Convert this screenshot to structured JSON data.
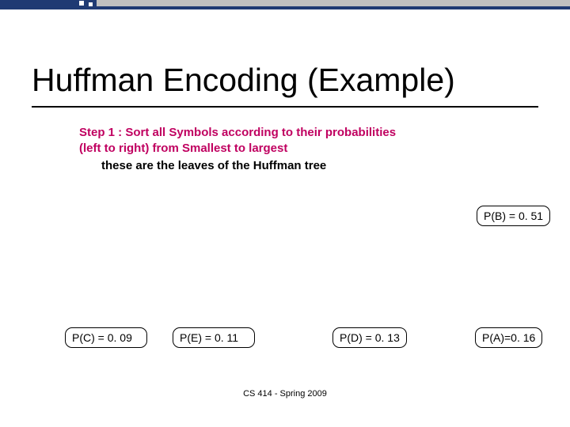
{
  "title": "Huffman Encoding (Example)",
  "step": {
    "line1": "Step 1 : Sort all Symbols  according to their probabilities",
    "line2": "(left to right) from Smallest to largest",
    "sub": "these are the  leaves of the Huffman tree"
  },
  "nodes": {
    "b": "P(B) = 0. 51",
    "c": "P(C) = 0. 09",
    "e": "P(E) = 0. 11",
    "d": "P(D) = 0. 13",
    "a": "P(A)=0. 16"
  },
  "footer": "CS 414 - Spring 2009"
}
